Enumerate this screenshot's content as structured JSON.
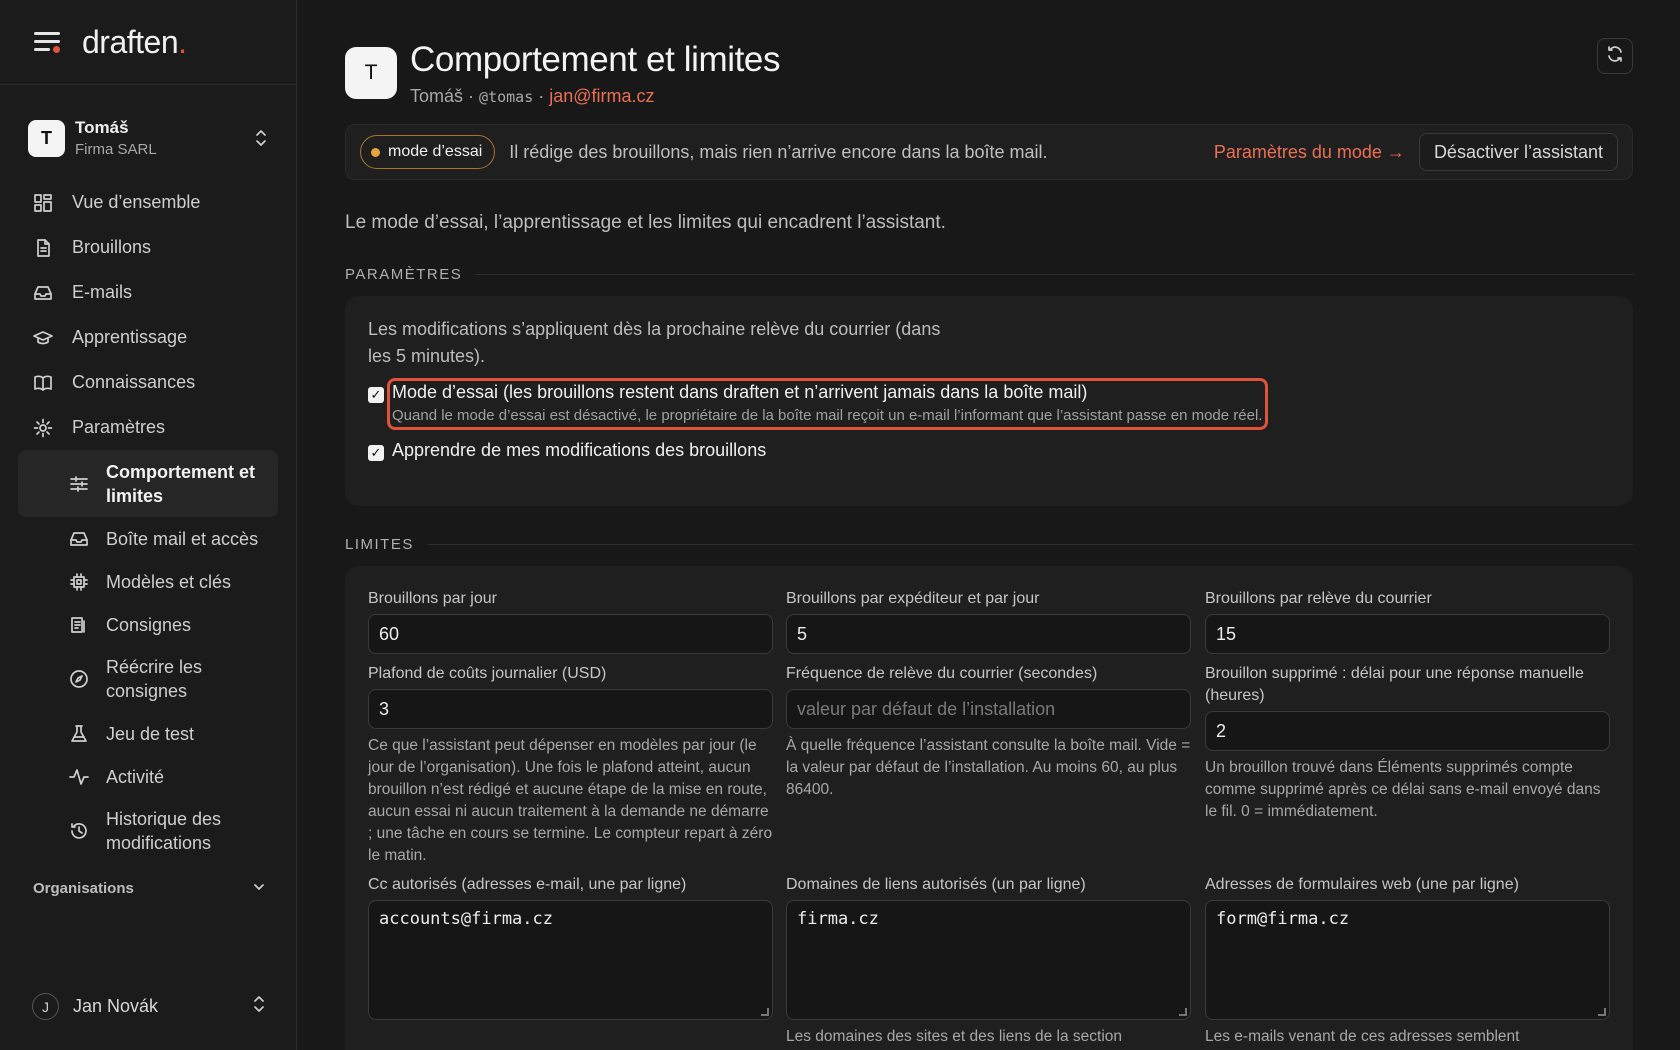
{
  "app": {
    "logo": "draften",
    "logo_dot": "."
  },
  "workspace": {
    "avatar": "T",
    "name": "Tomáš",
    "org": "Firma SARL"
  },
  "nav": [
    {
      "icon": "dashboard-icon",
      "label": "Vue d’ensemble"
    },
    {
      "icon": "document-icon",
      "label": "Brouillons"
    },
    {
      "icon": "inbox-icon",
      "label": "E-mails"
    },
    {
      "icon": "graduation-cap-icon",
      "label": "Apprentissage"
    },
    {
      "icon": "book-icon",
      "label": "Connaissances"
    },
    {
      "icon": "gear-icon",
      "label": "Paramètres"
    }
  ],
  "subnav": [
    {
      "icon": "sliders-icon",
      "label": "Comportement et limites",
      "active": true
    },
    {
      "icon": "inbox-icon",
      "label": "Boîte mail et accès"
    },
    {
      "icon": "chip-icon",
      "label": "Modèles et clés"
    },
    {
      "icon": "list-icon",
      "label": "Consignes"
    },
    {
      "icon": "compass-icon",
      "label": "Réécrire les consignes"
    },
    {
      "icon": "flask-icon",
      "label": "Jeu de test"
    },
    {
      "icon": "activity-icon",
      "label": "Activité"
    },
    {
      "icon": "history-icon",
      "label": "Historique des modifications"
    }
  ],
  "organisations_label": "Organisations",
  "user": {
    "initial": "J",
    "name": "Jan Novák"
  },
  "header": {
    "avatar": "T",
    "title": "Comportement et limites",
    "name": "Tomáš",
    "sep": "·",
    "handle": "@tomas",
    "email": "jan@firma.cz"
  },
  "banner": {
    "pill": "mode d’essai",
    "message": "Il rédige des brouillons, mais rien n’arrive encore dans la boîte mail.",
    "link": "Paramètres du mode →",
    "button": "Désactiver l’assistant"
  },
  "intro": "Le mode d’essai, l’apprentissage et les limites qui encadrent l’assistant.",
  "settings": {
    "section_title": "PARAMÈTRES",
    "note": "Les modifications s’appliquent dès la prochaine relève du courrier (dans les 5 minutes).",
    "trial": {
      "checked": true,
      "label": "Mode d’essai (les brouillons restent dans draften et n’arrivent jamais dans la boîte mail)",
      "help": "Quand le mode d’essai est désactivé, le propriétaire de la boîte mail reçoit un e-mail l’informant que l’assistant passe en mode réel."
    },
    "learn": {
      "checked": true,
      "label": "Apprendre de mes modifications des brouillons"
    }
  },
  "limits": {
    "section_title": "LIMITES",
    "drafts_per_day": {
      "label": "Brouillons par jour",
      "value": "60"
    },
    "drafts_per_sender": {
      "label": "Brouillons par expéditeur et par jour",
      "value": "5"
    },
    "drafts_per_fetch": {
      "label": "Brouillons par relève du courrier",
      "value": "15"
    },
    "daily_cost": {
      "label": "Plafond de coûts journalier (USD)",
      "value": "3",
      "help": "Ce que l’assistant peut dépenser en modèles par jour (le jour de l’organisation). Une fois le plafond atteint, aucun brouillon n’est rédigé et aucune étape de la mise en route, aucun essai ni aucun traitement à la demande ne démarre ; une tâche en cours se termine. Le compteur repart à zéro le matin."
    },
    "fetch_frequency": {
      "label": "Fréquence de relève du courrier (secondes)",
      "placeholder": "valeur par défaut de l’installation",
      "help": "À quelle fréquence l’assistant consulte la boîte mail. Vide = la valeur par défaut de l’installation. Au moins 60, au plus 86400."
    },
    "deleted_delay": {
      "label": "Brouillon supprimé : délai pour une réponse manuelle (heures)",
      "value": "2",
      "help": "Un brouillon trouvé dans Éléments supprimés compte comme supprimé après ce délai sans e-mail envoyé dans le fil. 0 = immédiatement."
    },
    "cc_allowed": {
      "label": "Cc autorisés (adresses e-mail, une par ligne)",
      "value": "accounts@firma.cz"
    },
    "link_domains": {
      "label": "Domaines de liens autorisés (un par ligne)",
      "value": "firma.cz",
      "help": "Les domaines des sites et des liens de la section"
    },
    "web_forms": {
      "label": "Adresses de formulaires web (une par ligne)",
      "value": "form@firma.cz",
      "help": "Les e-mails venant de ces adresses semblent"
    }
  },
  "colors": {
    "accent": "#ec6f55",
    "brand_dot": "#e0533b",
    "trial_dot": "#e8a33c",
    "highlight": "#e0533b"
  }
}
